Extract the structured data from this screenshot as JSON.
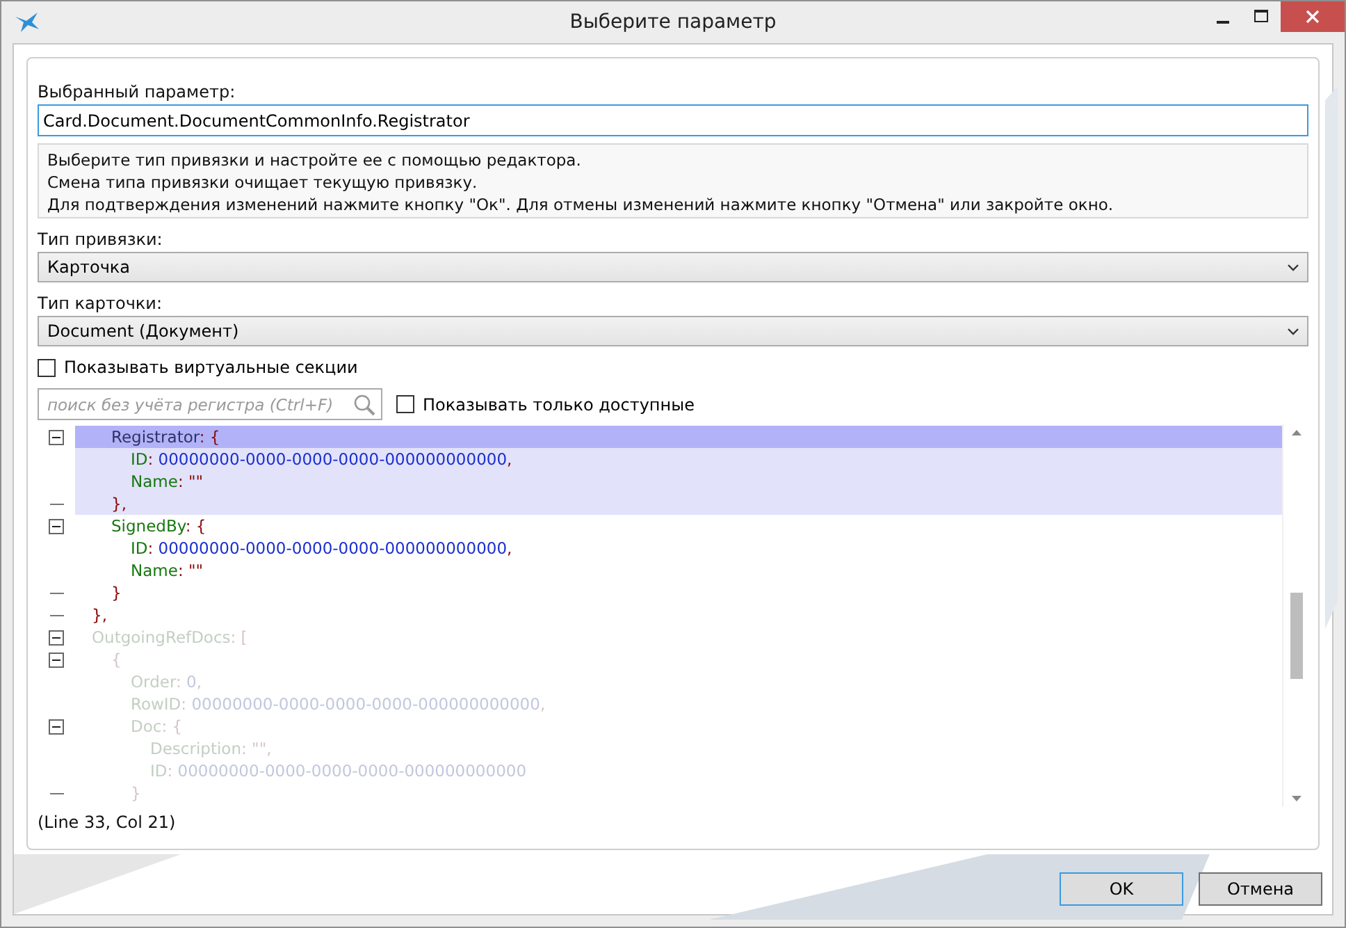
{
  "window": {
    "title": "Выберите параметр",
    "controls": [
      {
        "kind": "minimize"
      },
      {
        "kind": "maximize"
      },
      {
        "kind": "close"
      }
    ]
  },
  "selected_parameter": {
    "label": "Выбранный параметр:",
    "value": "Card.Document.DocumentCommonInfo.Registrator"
  },
  "hint_lines": [
    "Выберите тип привязки и настройте ее с помощью редактора.",
    "Смена типа привязки очищает текущую привязку.",
    "Для подтверждения изменений нажмите кнопку \"Ок\". Для отмены изменений нажмите кнопку \"Отмена\" или закройте окно."
  ],
  "binding_type": {
    "label": "Тип привязки:",
    "value": "Карточка"
  },
  "card_type": {
    "label": "Тип карточки:",
    "value": "Document (Документ)"
  },
  "show_virtual_sections": {
    "label": "Показывать виртуальные секции",
    "checked": false
  },
  "search": {
    "placeholder": "поиск без учёта регистра (Ctrl+F)"
  },
  "show_only_available": {
    "label": "Показывать только доступные",
    "checked": false
  },
  "editor_lines": [
    {
      "children": [
        {
          "kind": "fold_open",
          "selected": true,
          "in_block": true,
          "dimmed": false,
          "tokens": [
            {
              "kind": "name",
              "text": "Registrator"
            },
            {
              "kind": "punct",
              "text": ": {"
            }
          ],
          "children": [
            {
              "kind": "plain",
              "selected": false,
              "in_block": true,
              "dimmed": false,
              "tokens": [
                {
                  "kind": "key",
                  "text": "ID"
                },
                {
                  "kind": "punct",
                  "text": ": "
                },
                {
                  "kind": "value",
                  "text": "00000000-0000-0000-0000-000000000000"
                },
                {
                  "kind": "punct",
                  "text": ","
                }
              ]
            },
            {
              "kind": "plain",
              "selected": false,
              "in_block": true,
              "dimmed": false,
              "tokens": [
                {
                  "kind": "key",
                  "text": "Name"
                },
                {
                  "kind": "punct",
                  "text": ": \"\""
                }
              ]
            }
          ]
        },
        {
          "kind": "fold_end",
          "selected": false,
          "in_block": true,
          "dimmed": false,
          "tokens": [
            {
              "kind": "punct",
              "text": "},"
            }
          ]
        },
        {
          "kind": "fold_open",
          "selected": false,
          "in_block": false,
          "dimmed": false,
          "tokens": [
            {
              "kind": "key",
              "text": "SignedBy"
            },
            {
              "kind": "punct",
              "text": ": {"
            }
          ],
          "children": [
            {
              "kind": "plain",
              "selected": false,
              "in_block": false,
              "dimmed": false,
              "tokens": [
                {
                  "kind": "key",
                  "text": "ID"
                },
                {
                  "kind": "punct",
                  "text": ": "
                },
                {
                  "kind": "value",
                  "text": "00000000-0000-0000-0000-000000000000"
                },
                {
                  "kind": "punct",
                  "text": ","
                }
              ]
            },
            {
              "kind": "plain",
              "selected": false,
              "in_block": false,
              "dimmed": false,
              "tokens": [
                {
                  "kind": "key",
                  "text": "Name"
                },
                {
                  "kind": "punct",
                  "text": ": \"\""
                }
              ]
            }
          ]
        },
        {
          "kind": "fold_end",
          "selected": false,
          "in_block": false,
          "dimmed": false,
          "tokens": [
            {
              "kind": "punct",
              "text": "}"
            }
          ]
        }
      ]
    },
    {
      "kind": "fold_end",
      "selected": false,
      "in_block": false,
      "dimmed": false,
      "tokens": [
        {
          "kind": "punct",
          "text": "},"
        }
      ]
    },
    {
      "kind": "fold_open",
      "selected": false,
      "in_block": false,
      "dimmed": true,
      "tokens": [
        {
          "kind": "key",
          "text": "OutgoingRefDocs"
        },
        {
          "kind": "punct",
          "text": ": ["
        }
      ],
      "children": [
        {
          "kind": "fold_open",
          "selected": false,
          "in_block": false,
          "dimmed": true,
          "tokens": [
            {
              "kind": "punct",
              "text": "{"
            }
          ],
          "children": [
            {
              "kind": "plain",
              "selected": false,
              "in_block": false,
              "dimmed": true,
              "tokens": [
                {
                  "kind": "key",
                  "text": "Order"
                },
                {
                  "kind": "punct",
                  "text": ": "
                },
                {
                  "kind": "value",
                  "text": "0"
                },
                {
                  "kind": "punct",
                  "text": ","
                }
              ]
            },
            {
              "kind": "plain",
              "selected": false,
              "in_block": false,
              "dimmed": true,
              "tokens": [
                {
                  "kind": "key",
                  "text": "RowID"
                },
                {
                  "kind": "punct",
                  "text": ": "
                },
                {
                  "kind": "value",
                  "text": "00000000-0000-0000-0000-000000000000"
                },
                {
                  "kind": "punct",
                  "text": ","
                }
              ]
            },
            {
              "kind": "fold_open",
              "selected": false,
              "in_block": false,
              "dimmed": true,
              "tokens": [
                {
                  "kind": "key",
                  "text": "Doc"
                },
                {
                  "kind": "punct",
                  "text": ": {"
                }
              ],
              "children": [
                {
                  "kind": "plain",
                  "selected": false,
                  "in_block": false,
                  "dimmed": true,
                  "tokens": [
                    {
                      "kind": "key",
                      "text": "Description"
                    },
                    {
                      "kind": "punct",
                      "text": ": \"\","
                    }
                  ]
                },
                {
                  "kind": "plain",
                  "selected": false,
                  "in_block": false,
                  "dimmed": true,
                  "tokens": [
                    {
                      "kind": "key",
                      "text": "ID"
                    },
                    {
                      "kind": "punct",
                      "text": ": "
                    },
                    {
                      "kind": "value",
                      "text": "00000000-0000-0000-0000-000000000000"
                    }
                  ]
                }
              ]
            },
            {
              "kind": "fold_end",
              "selected": false,
              "in_block": false,
              "dimmed": true,
              "tokens": [
                {
                  "kind": "punct",
                  "text": "}"
                }
              ]
            }
          ]
        }
      ]
    }
  ],
  "cursor_position": "(Line 33, Col 21)",
  "buttons": [
    {
      "label": "OK",
      "default": true
    },
    {
      "label": "Отмена",
      "default": false
    }
  ]
}
